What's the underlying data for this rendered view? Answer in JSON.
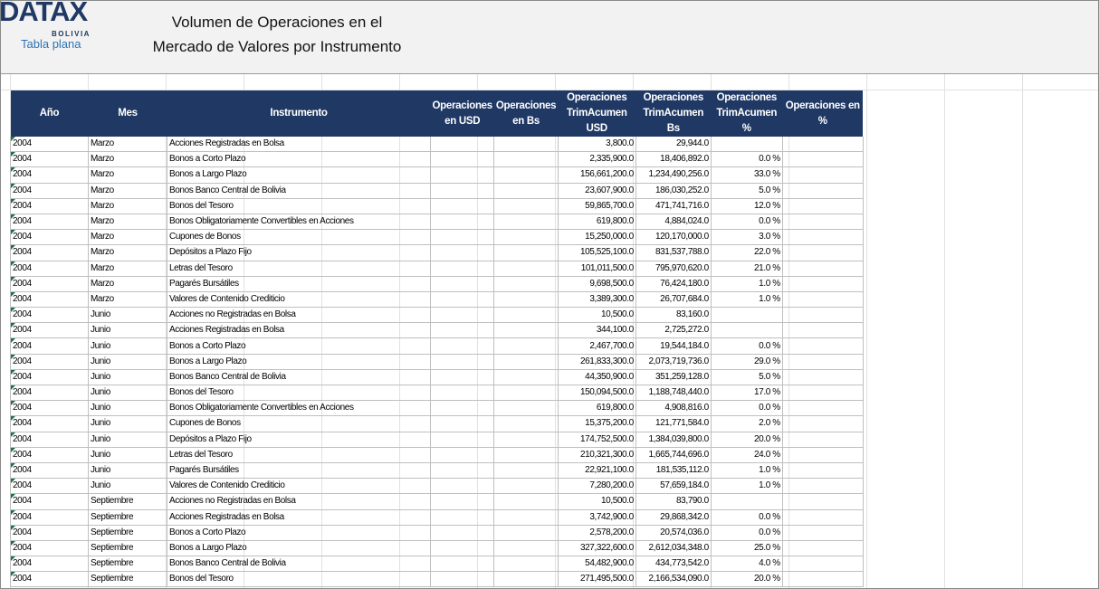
{
  "logo": {
    "brand": "DATAX",
    "country": "BOLIVIA",
    "tag": "Tabla plana"
  },
  "title": {
    "line1": "Volumen de Operaciones en el",
    "line2": "Mercado de Valores por Instrumento"
  },
  "table": {
    "columns": [
      "Año",
      "Mes",
      "Instrumento",
      "Operaciones en USD",
      "Operaciones en Bs",
      "Operaciones TrimAcumen USD",
      "Operaciones TrimAcumen Bs",
      "Operaciones TrimAcumen %",
      "Operaciones en %"
    ],
    "rows": [
      [
        "2004",
        "Marzo",
        "Acciones Registradas en Bolsa",
        "",
        "",
        "3,800.0",
        "29,944.0",
        "",
        ""
      ],
      [
        "2004",
        "Marzo",
        "Bonos a Corto Plazo",
        "",
        "",
        "2,335,900.0",
        "18,406,892.0",
        "0.0 %",
        ""
      ],
      [
        "2004",
        "Marzo",
        "Bonos a Largo Plazo",
        "",
        "",
        "156,661,200.0",
        "1,234,490,256.0",
        "33.0 %",
        ""
      ],
      [
        "2004",
        "Marzo",
        "Bonos Banco Central de Bolivia",
        "",
        "",
        "23,607,900.0",
        "186,030,252.0",
        "5.0 %",
        ""
      ],
      [
        "2004",
        "Marzo",
        "Bonos del Tesoro",
        "",
        "",
        "59,865,700.0",
        "471,741,716.0",
        "12.0 %",
        ""
      ],
      [
        "2004",
        "Marzo",
        "Bonos Obligatoriamente Convertibles en Acciones",
        "",
        "",
        "619,800.0",
        "4,884,024.0",
        "0.0 %",
        ""
      ],
      [
        "2004",
        "Marzo",
        "Cupones de Bonos",
        "",
        "",
        "15,250,000.0",
        "120,170,000.0",
        "3.0 %",
        ""
      ],
      [
        "2004",
        "Marzo",
        "Depósitos a Plazo Fijo",
        "",
        "",
        "105,525,100.0",
        "831,537,788.0",
        "22.0 %",
        ""
      ],
      [
        "2004",
        "Marzo",
        "Letras del Tesoro",
        "",
        "",
        "101,011,500.0",
        "795,970,620.0",
        "21.0 %",
        ""
      ],
      [
        "2004",
        "Marzo",
        "Pagarés Bursátiles",
        "",
        "",
        "9,698,500.0",
        "76,424,180.0",
        "1.0 %",
        ""
      ],
      [
        "2004",
        "Marzo",
        "Valores de Contenido Crediticio",
        "",
        "",
        "3,389,300.0",
        "26,707,684.0",
        "1.0 %",
        ""
      ],
      [
        "2004",
        "Junio",
        "Acciones no Registradas en Bolsa",
        "",
        "",
        "10,500.0",
        "83,160.0",
        "",
        ""
      ],
      [
        "2004",
        "Junio",
        "Acciones Registradas en Bolsa",
        "",
        "",
        "344,100.0",
        "2,725,272.0",
        "",
        ""
      ],
      [
        "2004",
        "Junio",
        "Bonos a Corto Plazo",
        "",
        "",
        "2,467,700.0",
        "19,544,184.0",
        "0.0 %",
        ""
      ],
      [
        "2004",
        "Junio",
        "Bonos a Largo Plazo",
        "",
        "",
        "261,833,300.0",
        "2,073,719,736.0",
        "29.0 %",
        ""
      ],
      [
        "2004",
        "Junio",
        "Bonos Banco Central de Bolivia",
        "",
        "",
        "44,350,900.0",
        "351,259,128.0",
        "5.0 %",
        ""
      ],
      [
        "2004",
        "Junio",
        "Bonos del Tesoro",
        "",
        "",
        "150,094,500.0",
        "1,188,748,440.0",
        "17.0 %",
        ""
      ],
      [
        "2004",
        "Junio",
        "Bonos Obligatoriamente Convertibles en Acciones",
        "",
        "",
        "619,800.0",
        "4,908,816.0",
        "0.0 %",
        ""
      ],
      [
        "2004",
        "Junio",
        "Cupones de Bonos",
        "",
        "",
        "15,375,200.0",
        "121,771,584.0",
        "2.0 %",
        ""
      ],
      [
        "2004",
        "Junio",
        "Depósitos a Plazo Fijo",
        "",
        "",
        "174,752,500.0",
        "1,384,039,800.0",
        "20.0 %",
        ""
      ],
      [
        "2004",
        "Junio",
        "Letras del Tesoro",
        "",
        "",
        "210,321,300.0",
        "1,665,744,696.0",
        "24.0 %",
        ""
      ],
      [
        "2004",
        "Junio",
        "Pagarés Bursátiles",
        "",
        "",
        "22,921,100.0",
        "181,535,112.0",
        "1.0 %",
        ""
      ],
      [
        "2004",
        "Junio",
        "Valores de Contenido Crediticio",
        "",
        "",
        "7,280,200.0",
        "57,659,184.0",
        "1.0 %",
        ""
      ],
      [
        "2004",
        "Septiembre",
        "Acciones no Registradas en Bolsa",
        "",
        "",
        "10,500.0",
        "83,790.0",
        "",
        ""
      ],
      [
        "2004",
        "Septiembre",
        "Acciones Registradas en Bolsa",
        "",
        "",
        "3,742,900.0",
        "29,868,342.0",
        "0.0 %",
        ""
      ],
      [
        "2004",
        "Septiembre",
        "Bonos a Corto Plazo",
        "",
        "",
        "2,578,200.0",
        "20,574,036.0",
        "0.0 %",
        ""
      ],
      [
        "2004",
        "Septiembre",
        "Bonos a Largo Plazo",
        "",
        "",
        "327,322,600.0",
        "2,612,034,348.0",
        "25.0 %",
        ""
      ],
      [
        "2004",
        "Septiembre",
        "Bonos Banco Central de Bolivia",
        "",
        "",
        "54,482,900.0",
        "434,773,542.0",
        "4.0 %",
        ""
      ],
      [
        "2004",
        "Septiembre",
        "Bonos del Tesoro",
        "",
        "",
        "271,495,500.0",
        "2,166,534,090.0",
        "20.0 %",
        ""
      ]
    ]
  }
}
